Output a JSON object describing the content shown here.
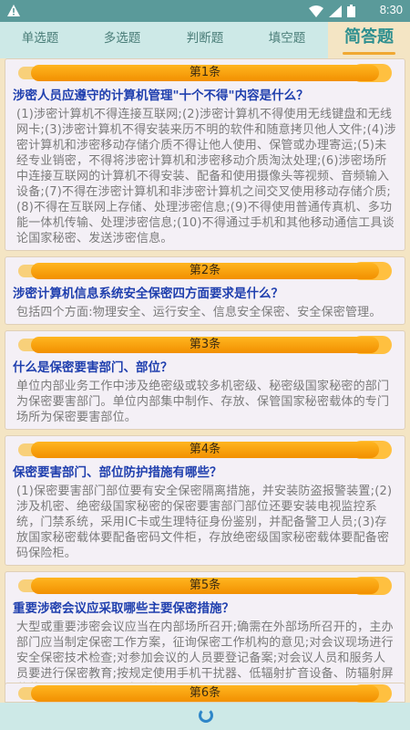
{
  "status": {
    "time": "8:30"
  },
  "tabs": [
    {
      "label": "单选题"
    },
    {
      "label": "多选题"
    },
    {
      "label": "判断题"
    },
    {
      "label": "填空题"
    },
    {
      "label": "简答题"
    }
  ],
  "items": [
    {
      "num": "第1条",
      "question": "涉密人员应遵守的计算机管理\"十个不得\"内容是什么？",
      "answer": "(1)涉密计算机不得连接互联网;(2)涉密计算机不得使用无线键盘和无线网卡;(3)涉密计算机不得安装来历不明的软件和随意拷贝他人文件;(4)涉密计算机和涉密移动存储介质不得让他人使用、保管或办理寄运;(5)未经专业销密，不得将涉密计算机和涉密移动介质淘汰处理;(6)涉密场所中连接互联网的计算机不得安装、配备和使用摄像头等视频、音频输入设备;(7)不得在涉密计算机和非涉密计算机之间交叉使用移动存储介质;(8)不得在互联网上存储、处理涉密信息;(9)不得使用普通传真机、多功能一体机传输、处理涉密信息;(10)不得通过手机和其他移动通信工具谈论国家秘密、发送涉密信息。"
    },
    {
      "num": "第2条",
      "question": "涉密计算机信息系统安全保密四方面要求是什么？",
      "answer": "包括四个方面:物理安全、运行安全、信息安全保密、安全保密管理。"
    },
    {
      "num": "第3条",
      "question": "什么是保密要害部门、部位？",
      "answer": "单位内部业务工作中涉及绝密级或较多机密级、秘密级国家秘密的部门为保密要害部门。单位内部集中制作、存放、保管国家秘密载体的专门场所为保密要害部位。"
    },
    {
      "num": "第4条",
      "question": "保密要害部门、部位防护措施有哪些？",
      "answer": "(1)保密要害部门部位要有安全保密隔离措施，并安装防盗报警装置;(2)涉及机密、绝密级国家秘密的保密要害部门部位还要安装电视监控系统，门禁系统，采用IC卡或生理特征身份鉴别，并配备警卫人员;(3)存放国家秘密载体要配备密码文件柜，存放绝密级国家秘密载体要配备密码保险柜。"
    },
    {
      "num": "第5条",
      "question": "重要涉密会议应采取哪些主要保密措施？",
      "answer": "大型或重要涉密会议应当在内部场所召开;确需在外部场所召开的，主办部门应当制定保密工作方案，征询保密工作机构的意见;对会议现场进行安全保密技术检查;对参加会议的人员要登记备案;对会议人员和服务人员要进行保密教育;按规定使用手机干扰器、低辐射扩音设备、防辐射屏幕装置，不得使用无线话筒。"
    },
    {
      "num": "第6条"
    }
  ]
}
